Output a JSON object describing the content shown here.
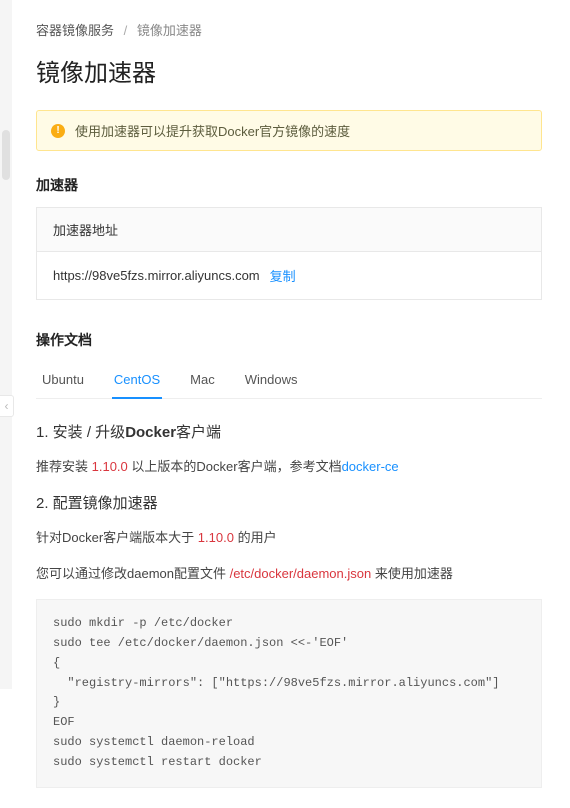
{
  "breadcrumb": {
    "root": "容器镜像服务",
    "current": "镜像加速器"
  },
  "page_title": "镜像加速器",
  "alert": {
    "text": "使用加速器可以提升获取Docker官方镜像的速度"
  },
  "accelerator": {
    "section_title": "加速器",
    "panel_header": "加速器地址",
    "url": "https://98ve5fzs.mirror.aliyuncs.com",
    "copy_label": "复制"
  },
  "docs": {
    "section_title": "操作文档",
    "tabs": [
      {
        "label": "Ubuntu",
        "active": false
      },
      {
        "label": "CentOS",
        "active": true
      },
      {
        "label": "Mac",
        "active": false
      },
      {
        "label": "Windows",
        "active": false
      }
    ],
    "step1": {
      "heading_prefix": "1. 安装 / 升级",
      "heading_strong": "Docker",
      "heading_suffix": "客户端",
      "recommend_prefix": "推荐安装 ",
      "recommend_version": "1.10.0",
      "recommend_mid": " 以上版本的Docker客户端，参考文档",
      "recommend_link": "docker-ce"
    },
    "step2": {
      "heading": "2. 配置镜像加速器",
      "line1_prefix": "针对Docker客户端版本大于 ",
      "line1_version": "1.10.0",
      "line1_suffix": " 的用户",
      "line2_prefix": "您可以通过修改daemon配置文件 ",
      "line2_path": "/etc/docker/daemon.json",
      "line2_suffix": " 来使用加速器",
      "code": "sudo mkdir -p /etc/docker\nsudo tee /etc/docker/daemon.json <<-'EOF'\n{\n  \"registry-mirrors\": [\"https://98ve5fzs.mirror.aliyuncs.com\"]\n}\nEOF\nsudo systemctl daemon-reload\nsudo systemctl restart docker"
    }
  }
}
